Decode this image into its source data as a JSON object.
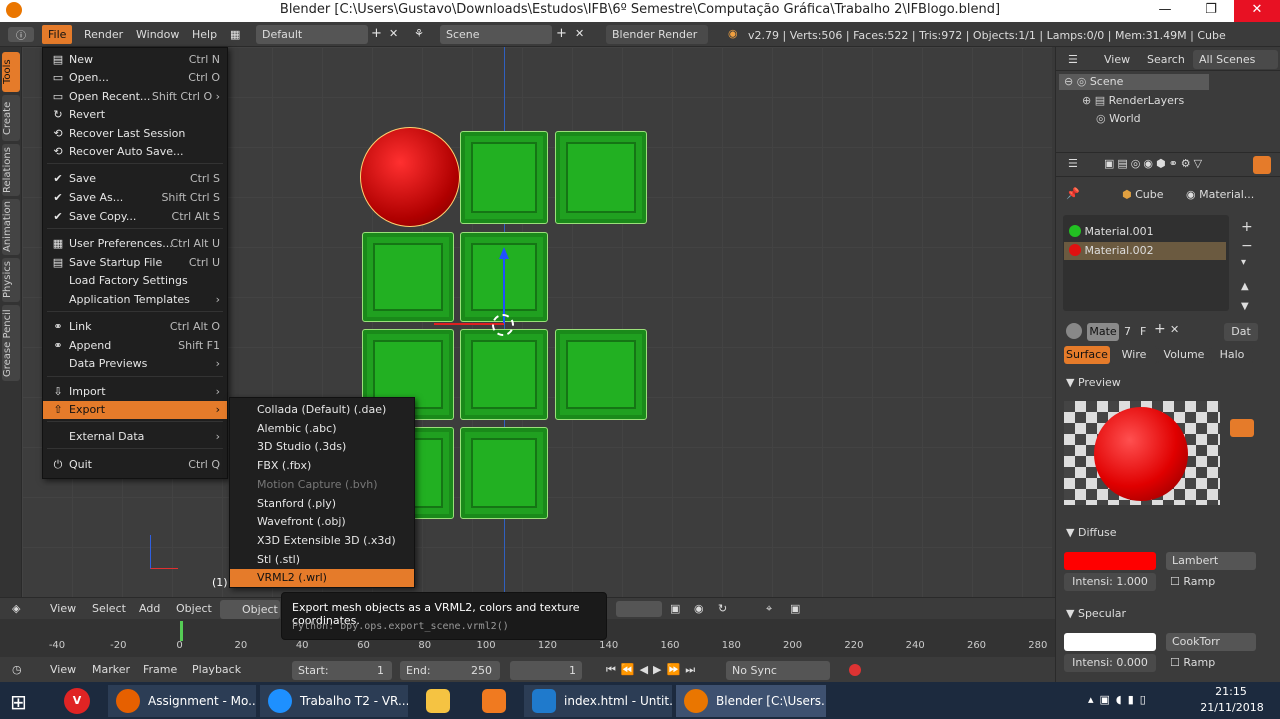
{
  "window": {
    "title": "Blender [C:\\Users\\Gustavo\\Downloads\\Estudos\\IFB\\6º Semestre\\Computação Gráfica\\Trabalho 2\\IFBlogo.blend]",
    "minimize": "—",
    "maximize": "❐",
    "close": "✕"
  },
  "infobar": {
    "menus": [
      "File",
      "Render",
      "Window",
      "Help"
    ],
    "layout": "Default",
    "scene": "Scene",
    "engine": "Blender Render",
    "stats": "v2.79 | Verts:506 | Faces:522 | Tris:972 | Objects:1/1 | Lamps:0/0 | Mem:31.49M | Cube"
  },
  "tool_tabs": [
    "Tools",
    "Create",
    "Relations",
    "Animation",
    "Physics",
    "Grease Pencil"
  ],
  "file_menu": [
    {
      "icon": "new-icon",
      "glyph": "▤",
      "label": "New",
      "shortcut": "Ctrl N"
    },
    {
      "icon": "open-icon",
      "glyph": "▭",
      "label": "Open...",
      "shortcut": "Ctrl O"
    },
    {
      "icon": "open-recent-icon",
      "glyph": "▭",
      "label": "Open Recent...",
      "shortcut": "Shift Ctrl O  ›"
    },
    {
      "icon": "revert-icon",
      "glyph": "↻",
      "label": "Revert",
      "shortcut": ""
    },
    {
      "icon": "recover-icon",
      "glyph": "⟲",
      "label": "Recover Last Session",
      "shortcut": ""
    },
    {
      "icon": "recover-auto-icon",
      "glyph": "⟲",
      "label": "Recover Auto Save...",
      "shortcut": ""
    },
    {
      "icon": "save-icon",
      "glyph": "✔",
      "label": "Save",
      "shortcut": "Ctrl S"
    },
    {
      "icon": "save-as-icon",
      "glyph": "✔",
      "label": "Save As...",
      "shortcut": "Shift Ctrl S"
    },
    {
      "icon": "save-copy-icon",
      "glyph": "✔",
      "label": "Save Copy...",
      "shortcut": "Ctrl Alt S"
    },
    {
      "icon": "preferences-icon",
      "glyph": "▦",
      "label": "User Preferences...",
      "shortcut": "Ctrl Alt U"
    },
    {
      "icon": "save-startup-icon",
      "glyph": "▤",
      "label": "Save Startup File",
      "shortcut": "Ctrl U"
    },
    {
      "icon": "",
      "glyph": "",
      "label": "Load Factory Settings",
      "shortcut": ""
    },
    {
      "icon": "",
      "glyph": "",
      "label": "Application Templates",
      "shortcut": "›"
    },
    {
      "icon": "link-icon",
      "glyph": "⚭",
      "label": "Link",
      "shortcut": "Ctrl Alt O"
    },
    {
      "icon": "append-icon",
      "glyph": "⚭",
      "label": "Append",
      "shortcut": "Shift F1"
    },
    {
      "icon": "",
      "glyph": "",
      "label": "Data Previews",
      "shortcut": "›"
    },
    {
      "icon": "import-icon",
      "glyph": "⇩",
      "label": "Import",
      "shortcut": "›"
    },
    {
      "icon": "export-icon",
      "glyph": "⇧",
      "label": "Export",
      "shortcut": "›"
    },
    {
      "icon": "external-data-icon",
      "glyph": "",
      "label": "External Data",
      "shortcut": "›"
    },
    {
      "icon": "quit-icon",
      "glyph": "⏻",
      "label": "Quit",
      "shortcut": "Ctrl Q"
    }
  ],
  "export_menu": [
    "Collada (Default) (.dae)",
    "Alembic (.abc)",
    "3D Studio (.3ds)",
    "FBX (.fbx)",
    "Motion Capture (.bvh)",
    "Stanford (.ply)",
    "Wavefront (.obj)",
    "X3D Extensible 3D (.x3d)",
    "Stl (.stl)",
    "VRML2 (.wrl)"
  ],
  "tooltip": {
    "description": "Export mesh objects as a VRML2, colors and texture coordinates.",
    "python": "Python: bpy.ops.export_scene.vrml2()"
  },
  "viewport": {
    "frame_label": "(1)"
  },
  "view_header": {
    "items": [
      "View",
      "Select",
      "Add",
      "Object"
    ],
    "mode": "Object M"
  },
  "timeline": {
    "ticks": [
      "-40",
      "-20",
      "0",
      "20",
      "40",
      "60",
      "80",
      "100",
      "120",
      "140",
      "160",
      "180",
      "200",
      "220",
      "240",
      "260",
      "280"
    ],
    "header": [
      "View",
      "Marker",
      "Frame",
      "Playback"
    ],
    "start": "Start:",
    "start_val": "1",
    "end": "End:",
    "end_val": "250",
    "current": "1",
    "sync": "No Sync"
  },
  "outliner": {
    "menus": [
      "View",
      "Search"
    ],
    "filter": "All Scenes",
    "items": [
      "Scene",
      "RenderLayers",
      "World"
    ]
  },
  "properties": {
    "object": "Cube",
    "material_crumb": "Material...",
    "slots": [
      {
        "name": "Material.001",
        "color": "#22c022"
      },
      {
        "name": "Material.002",
        "color": "#e01010"
      }
    ],
    "mat_field": "Mate",
    "users": "7",
    "fake": "F",
    "data": "Dat",
    "tabs": [
      "Surface",
      "Wire",
      "Volume",
      "Halo"
    ],
    "preview_label": "Preview",
    "diffuse_label": "Diffuse",
    "diffuse_color": "#ff0000",
    "diffuse_shader": "Lambert",
    "diffuse_intensity": "Intensi: 1.000",
    "ramp": "Ramp",
    "specular_label": "Specular",
    "specular_color": "#ffffff",
    "specular_shader": "CookTorr",
    "specular_intensity": "Intensi: 0.000"
  },
  "taskbar": {
    "tasks": [
      "Assignment - Mo...",
      "Trabalho T2 - VR...",
      "",
      "",
      "index.html - Untit...",
      "Blender [C:\\Users..."
    ],
    "time": "21:15",
    "date": "21/11/2018"
  }
}
